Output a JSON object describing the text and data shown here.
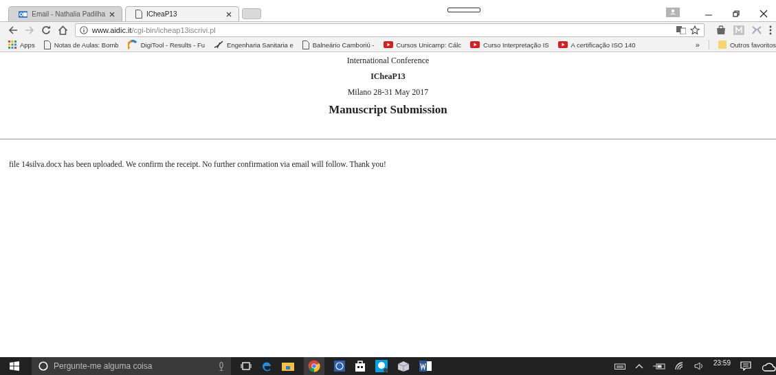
{
  "tabs": [
    {
      "label": "Email - Nathalia Padilha",
      "kind": "mail",
      "selected": false
    },
    {
      "label": "ICheaP13",
      "kind": "page",
      "selected": true
    }
  ],
  "address_bar": {
    "domain": "www.aidic.it",
    "path": "/cgi-bin/icheap13iscrivi.pl"
  },
  "bookmarks": [
    {
      "label": "Apps",
      "kind": "apps"
    },
    {
      "label": "Notas de Aulas: Bomb",
      "kind": "page"
    },
    {
      "label": "DigiTool - Results - Fu",
      "kind": "arc"
    },
    {
      "label": "Engenharia Sanitaria e",
      "kind": "swoosh"
    },
    {
      "label": "Balneário Camboriú -",
      "kind": "page"
    },
    {
      "label": "Cursos Unicamp: Cálc",
      "kind": "video"
    },
    {
      "label": "Curso Interpretação IS",
      "kind": "video"
    },
    {
      "label": "A certificação ISO 140",
      "kind": "video"
    }
  ],
  "bookmarks_more": "»",
  "other_bookmarks": "Outros favoritos",
  "page": {
    "lines": [
      {
        "text": "International Conference",
        "kind": "plain"
      },
      {
        "text": "ICheaP13",
        "kind": "bold"
      },
      {
        "text": "Milano 28-31 May 2017",
        "kind": "plain"
      },
      {
        "text": "Manuscript Submission",
        "kind": "heading"
      }
    ],
    "message": "file 14silva.docx has been uploaded. We confirm the receipt. No further confirmation via email will follow. Thank you!"
  },
  "taskbar": {
    "search_placeholder": "Pergunte-me alguma coisa",
    "time": "23:59"
  }
}
